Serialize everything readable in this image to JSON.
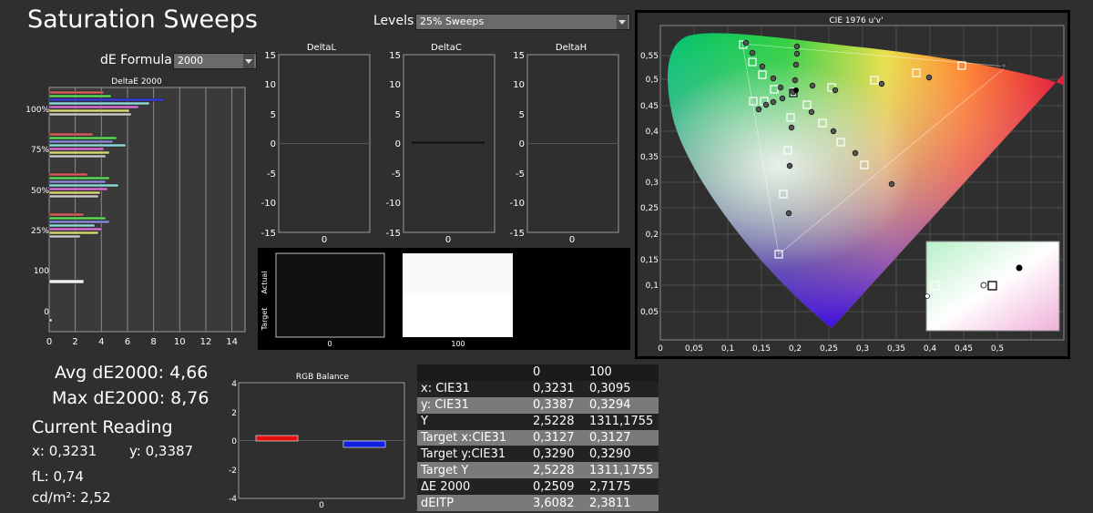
{
  "page_title": "Saturation Sweeps",
  "levels": {
    "label": "Levels:",
    "value": "25% Sweeps"
  },
  "de_formula": {
    "label": "dE Formula:",
    "value": "2000"
  },
  "deltae_chart": {
    "title": "DeltaE 2000",
    "y_labels": [
      "100%",
      "75%",
      "50%",
      "25%",
      "100",
      "0"
    ],
    "x_ticks": [
      "0",
      "2",
      "4",
      "6",
      "8",
      "10",
      "12",
      "14"
    ]
  },
  "delta_charts": {
    "titles": [
      "DeltaL",
      "DeltaC",
      "DeltaH"
    ],
    "y_ticks": [
      "15",
      "10",
      "5",
      "0",
      "-5",
      "-10",
      "-15"
    ],
    "x_label": "0"
  },
  "swatches": {
    "actual_label": "Actual",
    "target_label": "Target",
    "labels": [
      "0",
      "100"
    ]
  },
  "cie_chart": {
    "title": "CIE 1976 u'v'",
    "y_ticks": [
      "0,55",
      "0,5",
      "0,45",
      "0,4",
      "0,35",
      "0,3",
      "0,25",
      "0,2",
      "0,15",
      "0,1",
      "0,05"
    ],
    "x_ticks": [
      "0",
      "0,05",
      "0,1",
      "0,15",
      "0,2",
      "0,25",
      "0,3",
      "0,35",
      "0,4",
      "0,45",
      "0,5"
    ]
  },
  "summary": {
    "avg": "Avg dE2000: 4,66",
    "max": "Max dE2000: 8,76",
    "current_reading": "Current Reading",
    "x": "x: 0,3231",
    "y": "y: 0,3387",
    "fl": "fL: 0,74",
    "cdm2": "cd/m²: 2,52"
  },
  "rgb_balance": {
    "title": "RGB Balance",
    "y_ticks": [
      "4",
      "2",
      "0",
      "-2",
      "-4"
    ],
    "x_label": "0",
    "colors": {
      "red": "#e01010",
      "blue": "#1020e0"
    }
  },
  "table": {
    "headers": [
      "",
      "0",
      "100"
    ],
    "rows": [
      [
        "x: CIE31",
        "0,3231",
        "0,3095"
      ],
      [
        "y: CIE31",
        "0,3387",
        "0,3294"
      ],
      [
        "Y",
        "2,5228",
        "1311,1755"
      ],
      [
        "Target x:CIE31",
        "0,3127",
        "0,3127"
      ],
      [
        "Target y:CIE31",
        "0,3290",
        "0,3290"
      ],
      [
        "Target Y",
        "2,5228",
        "1311,1755"
      ],
      [
        "ΔE 2000",
        "0,2509",
        "2,7175"
      ],
      [
        "dEITP",
        "3,6082",
        "2,3811"
      ]
    ]
  }
}
